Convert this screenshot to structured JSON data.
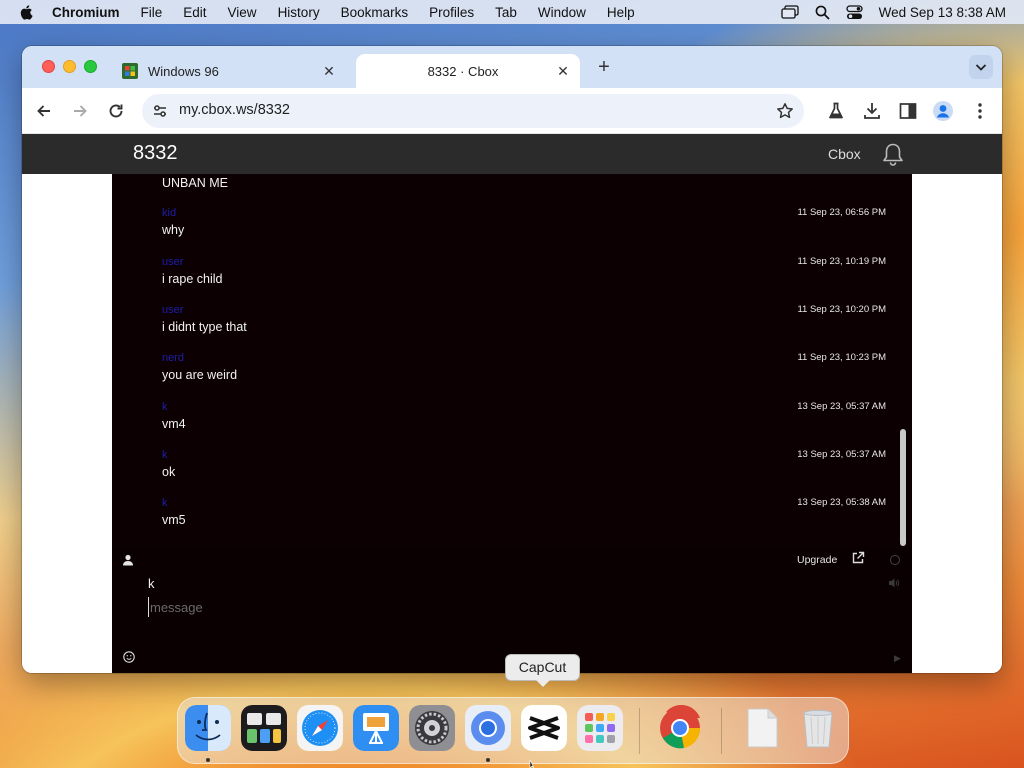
{
  "menubar": {
    "app_name": "Chromium",
    "items": [
      "File",
      "Edit",
      "View",
      "History",
      "Bookmarks",
      "Profiles",
      "Tab",
      "Window",
      "Help"
    ],
    "datetime": "Wed Sep 13  8:38 AM",
    "icons": [
      "apple-icon",
      "window-switcher-icon",
      "search-icon",
      "control-center-icon"
    ]
  },
  "browser": {
    "tabs": [
      {
        "title": "Windows 96",
        "favicon": "windows-icon",
        "active": false
      },
      {
        "title": "8332 · Cbox",
        "favicon": "none",
        "active": true
      }
    ],
    "url": "my.cbox.ws/8332"
  },
  "app": {
    "brand": "8332",
    "cbox_link": "Cbox",
    "messages": [
      {
        "name": "",
        "time": "",
        "text": "UNBAN ME"
      },
      {
        "name": "kid",
        "time": "11 Sep 23, 06:56 PM",
        "text": "why"
      },
      {
        "name": "user",
        "time": "11 Sep 23, 10:19 PM",
        "text": "i rape child"
      },
      {
        "name": "user",
        "time": "11 Sep 23, 10:20 PM",
        "text": "i didnt type that"
      },
      {
        "name": "nerd",
        "time": "11 Sep 23, 10:23 PM",
        "text": "you are weird"
      },
      {
        "name": "k",
        "time": "13 Sep 23, 05:37 AM",
        "text": "vm4"
      },
      {
        "name": "k",
        "time": "13 Sep 23, 05:37 AM",
        "text": "ok"
      },
      {
        "name": "k",
        "time": "13 Sep 23, 05:38 AM",
        "text": "vm5"
      }
    ],
    "compose": {
      "upgrade": "Upgrade",
      "nickname": "k",
      "message_placeholder": "message"
    }
  },
  "dock": {
    "tooltip": "CapCut",
    "apps": [
      "Finder",
      "Mission Control",
      "Safari",
      "Keynote",
      "System Settings",
      "Chromium",
      "CapCut",
      "Launchpad",
      "Google Chrome",
      "Documents",
      "Trash"
    ]
  },
  "colors": {
    "accent": "#1a73e8",
    "chat_bg": "#0c0002",
    "site_bar": "#2b2b2b",
    "name_color": "#1e1ea8"
  }
}
